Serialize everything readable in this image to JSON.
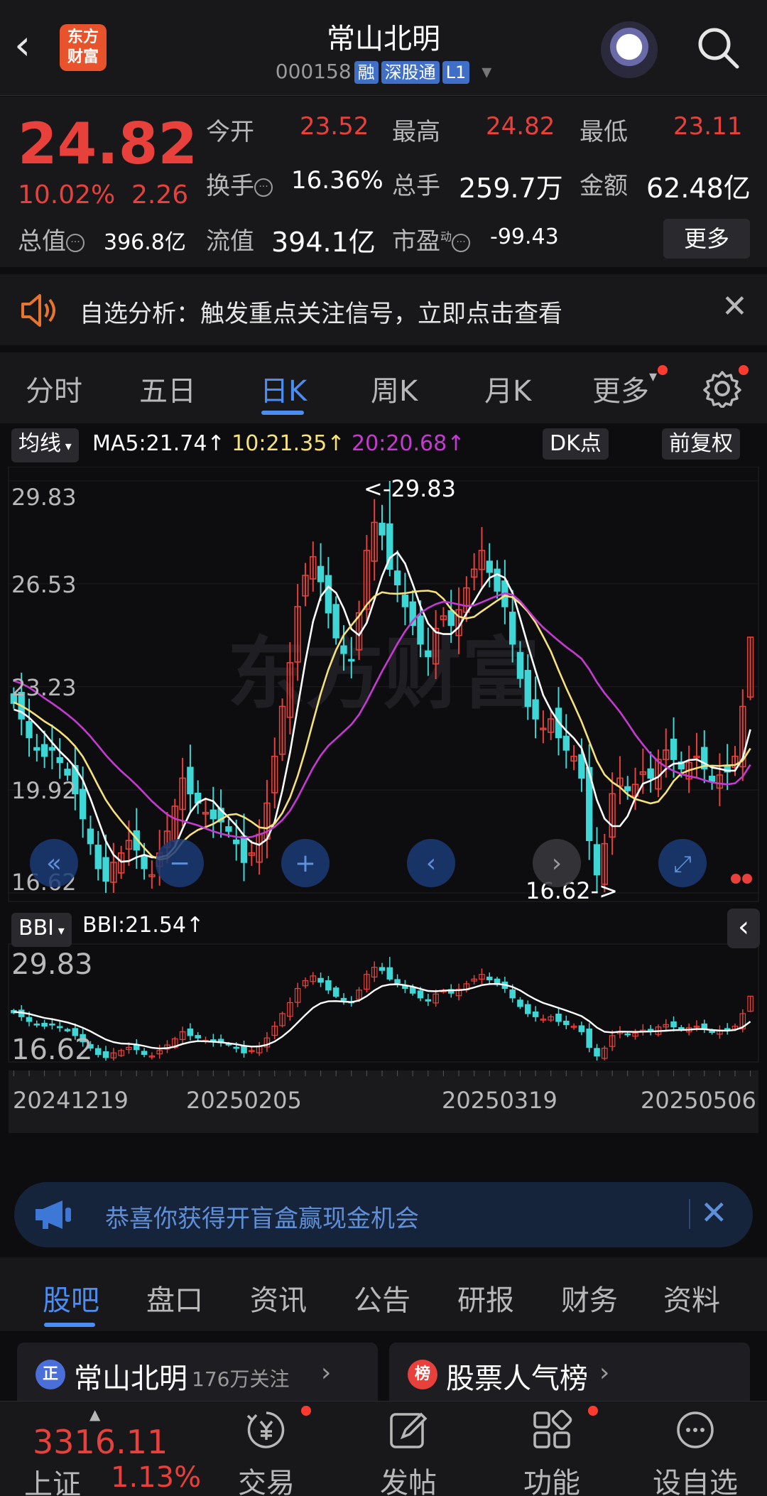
{
  "header": {
    "back_glyph": "‹",
    "logo_text": "东方\n财富",
    "stock_name": "常山北明",
    "stock_code": "000158",
    "tags": [
      "融",
      "深股通",
      "L1"
    ],
    "dropdown_glyph": "▾"
  },
  "quote": {
    "price": "24.82",
    "change_pct": "10.02%",
    "change": "2.26",
    "open_label": "今开",
    "open": "23.52",
    "high_label": "最高",
    "high": "24.82",
    "low_label": "最低",
    "low": "23.11",
    "turnover_label": "换手",
    "turnover": "16.36%",
    "volume_label": "总手",
    "volume": "259.7万",
    "amount_label": "金额",
    "amount": "62.48亿",
    "mktcap_label": "总值",
    "mktcap": "396.8亿",
    "float_label": "流值",
    "float_cap": "394.1亿",
    "pe_label": "市盈",
    "pe_sup": "动",
    "pe": "-99.43",
    "more_label": "更多",
    "info_glyph": "···"
  },
  "notice": {
    "text": "自选分析：触发重点关注信号，立即点击查看",
    "close_glyph": "✕"
  },
  "tabs": [
    "分时",
    "五日",
    "日K",
    "周K",
    "月K",
    "更多"
  ],
  "tabs_more_caret": "▾",
  "active_tab": "日K",
  "chart": {
    "ma_selector": "均线",
    "ma5": "MA5:21.74",
    "ma10": "10:21.35",
    "ma20": "20:20.68",
    "up_arrow": "↑",
    "dk_button": "DK点",
    "adjust_button": "前复权",
    "high_marker": "<-29.83",
    "low_marker": "16.62->",
    "y_ticks": [
      "29.83",
      "26.53",
      "23.23",
      "19.92",
      "16.62"
    ],
    "watermark": "东方财富",
    "bbi_selector": "BBI",
    "bbi_value": "BBI:21.54",
    "bbi_y_ticks": [
      "29.83",
      "16.62"
    ],
    "dates": [
      "20241219",
      "20250205",
      "20250319",
      "20250506"
    ],
    "control_glyphs": [
      "«",
      "−",
      "+",
      "‹",
      "›",
      "⤢"
    ],
    "collapse_glyph": "‹",
    "colors": {
      "up": "#e8403a",
      "down": "#3fd6d6",
      "ma5": "#ffffff",
      "ma10": "#f5e27a",
      "ma20": "#c53ad1",
      "bbi": "#ffffff"
    }
  },
  "chart_data": {
    "type": "candlestick",
    "title": "",
    "ylim": [
      16.62,
      29.83
    ],
    "high": 29.83,
    "low": 16.62,
    "x_labels": [
      "20241219",
      "20250205",
      "20250319",
      "20250506"
    ],
    "series": [
      {
        "name": "MA5",
        "last": 21.74
      },
      {
        "name": "10",
        "last": 21.35
      },
      {
        "name": "20",
        "last": 20.68
      },
      {
        "name": "BBI",
        "last": 21.54
      }
    ],
    "close_approx": [
      22.7,
      22.2,
      21.6,
      21.2,
      21.0,
      21.2,
      20.8,
      20.4,
      19.8,
      19.0,
      18.2,
      17.4,
      17.0,
      17.6,
      17.9,
      18.3,
      18.0,
      17.4,
      17.2,
      17.9,
      18.6,
      19.4,
      20.3,
      19.8,
      19.5,
      19.2,
      19.0,
      18.9,
      18.6,
      18.2,
      17.6,
      17.9,
      18.5,
      19.5,
      21.0,
      22.6,
      24.0,
      25.8,
      26.8,
      27.4,
      26.6,
      25.6,
      24.8,
      24.3,
      24.1,
      25.6,
      27.6,
      28.5,
      28.1,
      27.0,
      26.5,
      25.8,
      25.2,
      24.6,
      24.2,
      25.1,
      25.5,
      25.2,
      25.7,
      26.4,
      27.0,
      27.6,
      26.9,
      26.3,
      25.8,
      24.6,
      23.5,
      22.6,
      22.2,
      21.9,
      22.2,
      21.6,
      21.2,
      21.0,
      20.3,
      18.3,
      17.2,
      18.2,
      19.8,
      20.3,
      19.9,
      20.1,
      20.5,
      20.3,
      20.9,
      21.2,
      20.9,
      20.6,
      20.8,
      21.0,
      20.6,
      20.2,
      20.4,
      20.5,
      21.0,
      22.6,
      24.82
    ]
  },
  "banner": {
    "text": "恭喜你获得开盲盒赢现金机会",
    "close_glyph": "✕"
  },
  "bottom_tabs": [
    "股吧",
    "盘口",
    "资讯",
    "公告",
    "研报",
    "财务",
    "资料"
  ],
  "active_bottom_tab": "股吧",
  "cards": [
    {
      "icon": "正",
      "title": "常山北明",
      "sub": "176万关注",
      "chevron": "›"
    },
    {
      "icon": "榜",
      "title": "股票人气榜",
      "sub": "",
      "chevron": "›"
    }
  ],
  "index": {
    "value": "3316.11",
    "name": "上证",
    "pct": "1.13%",
    "caret": "▲"
  },
  "nav": [
    "交易",
    "发帖",
    "功能",
    "设自选"
  ]
}
